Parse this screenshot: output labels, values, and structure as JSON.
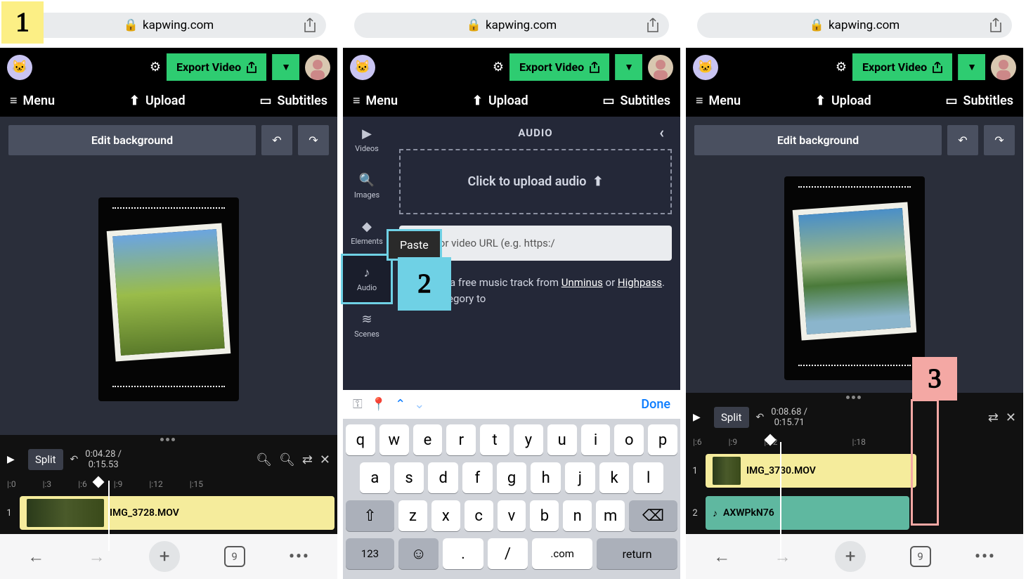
{
  "url": "kapwing.com",
  "exportLabel": "Export Video",
  "menu": {
    "menu": "Menu",
    "upload": "Upload",
    "subtitles": "Subtitles"
  },
  "panel1": {
    "editBg": "Edit background",
    "time": {
      "current": "0:04.28 /",
      "total": "0:15.53"
    },
    "split": "Split",
    "ruler": [
      "|:0",
      "|:3",
      "|:6",
      "|:9",
      "|:12",
      "|:15"
    ],
    "track1": {
      "no": "1",
      "label": "IMG_3728.MOV"
    }
  },
  "panel2": {
    "side": {
      "videos": "Videos",
      "images": "Images",
      "elements": "Elements",
      "audio": "Audio",
      "scenes": "Scenes"
    },
    "header": "AUDIO",
    "drop": "Click to upload audio",
    "paste": "Paste",
    "urlPlaceholder": "audio or video URL (e.g. https:/",
    "hint1": "or, choose a free music track from ",
    "link1": "Unminus",
    "hintOr": " or ",
    "link2": "Highpass",
    "hint2": ". Click a category to ",
    "kbDone": "Done",
    "kb": {
      "r1": [
        "q",
        "w",
        "e",
        "r",
        "t",
        "y",
        "u",
        "i",
        "o",
        "p"
      ],
      "r2": [
        "a",
        "s",
        "d",
        "f",
        "g",
        "h",
        "j",
        "k",
        "l"
      ],
      "r3": [
        "z",
        "x",
        "c",
        "v",
        "b",
        "n",
        "m"
      ],
      "num": "123",
      "emoji": "☺",
      "dot": ".",
      "slash": "/",
      "com": ".com",
      "ret": "return"
    }
  },
  "panel3": {
    "editBg": "Edit background",
    "time": {
      "current": "0:08.68 /",
      "total": "0:15.71"
    },
    "split": "Split",
    "ruler": [
      "|:6",
      "|:9",
      "|:12",
      "",
      "|:18"
    ],
    "track1": {
      "no": "1",
      "label": "IMG_3730.MOV"
    },
    "track2": {
      "no": "2",
      "label": "AXWPkN76"
    }
  },
  "tabsCount": "9"
}
